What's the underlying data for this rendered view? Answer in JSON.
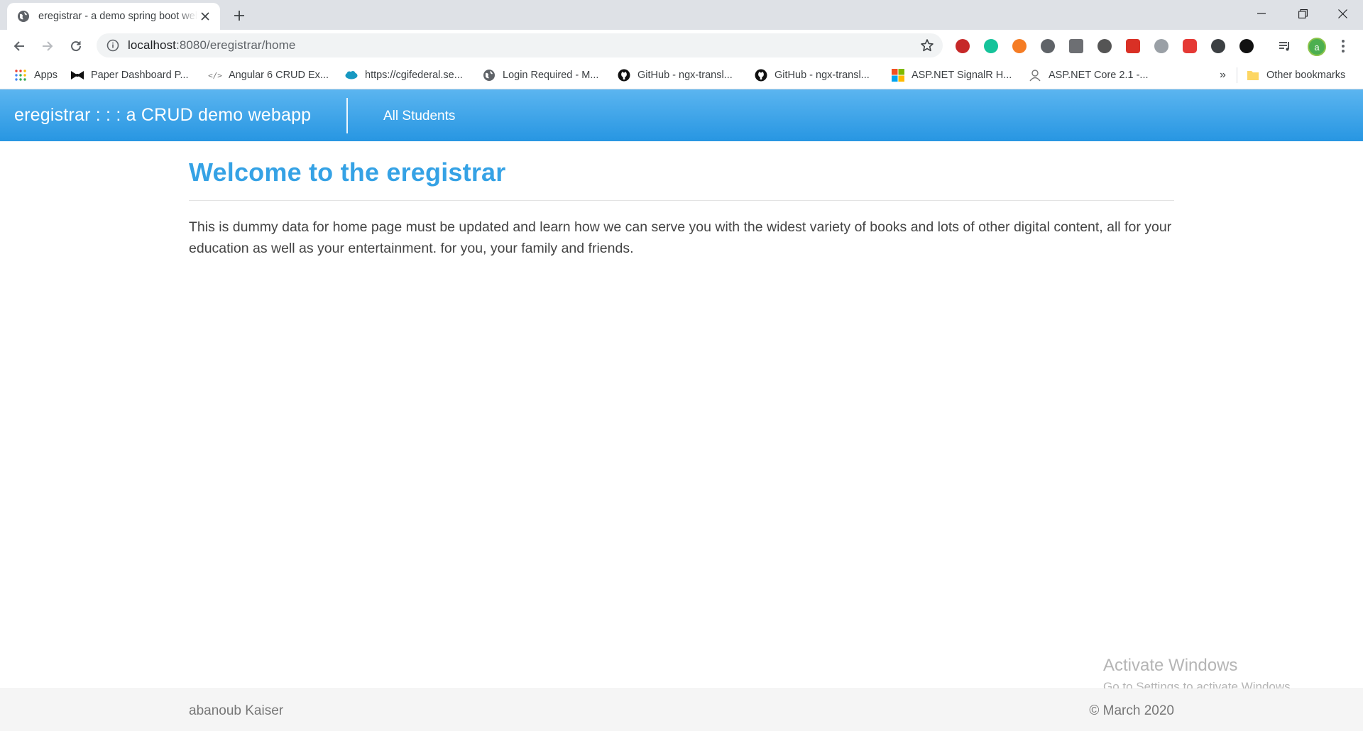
{
  "browser": {
    "tab_title": "eregistrar - a demo spring boot webapp",
    "url_host": "localhost",
    "url_path": ":8080/eregistrar/home",
    "more_bookmarks": "»",
    "avatar_letter": "a",
    "bookmarks": [
      {
        "label": "Apps",
        "icon": "apps-grid-icon"
      },
      {
        "label": "Paper Dashboard P...",
        "icon": "bowtie-icon"
      },
      {
        "label": "Angular 6 CRUD Ex...",
        "icon": "code-icon"
      },
      {
        "label": "https://cgifederal.se...",
        "icon": "salesforce-cloud-icon"
      },
      {
        "label": "Login Required - M...",
        "icon": "globe-icon"
      },
      {
        "label": "GitHub - ngx-transl...",
        "icon": "github-icon"
      },
      {
        "label": "GitHub - ngx-transl...",
        "icon": "github-icon"
      },
      {
        "label": "ASP.NET SignalR H...",
        "icon": "microsoft-logo-icon"
      },
      {
        "label": "ASP.NET Core 2.1 -...",
        "icon": "person-icon"
      }
    ],
    "other_bookmarks": "Other bookmarks"
  },
  "app": {
    "brand": "eregistrar : : : a CRUD demo webapp",
    "nav_all_students": "All Students",
    "heading": "Welcome to the eregistrar",
    "intro": "This is dummy data for home page must be updated and learn how we can serve you with the widest variety of books and lots of other digital content, all for your education as well as your entertainment. for you, your family and friends.",
    "footer_left": "abanoub Kaiser",
    "footer_right": "© March 2020"
  },
  "os": {
    "activate_title": "Activate Windows",
    "activate_sub": "Go to Settings to activate Windows."
  },
  "colors": {
    "navbar": "#2796e2",
    "heading": "#35a2e5"
  }
}
